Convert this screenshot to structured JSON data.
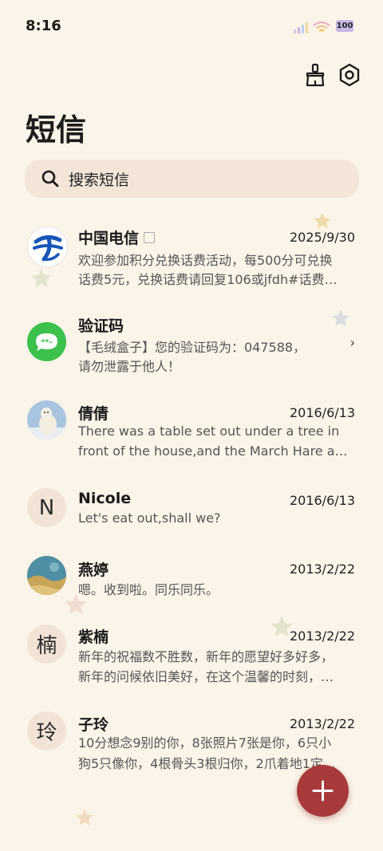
{
  "status": {
    "time": "8:16",
    "battery": "100"
  },
  "header": {
    "title": "短信",
    "icons": [
      "broom-icon",
      "settings-icon"
    ]
  },
  "search": {
    "placeholder": "搜索短信"
  },
  "messages": [
    {
      "name": "中国电信",
      "date": "2025/9/30",
      "line1": "欢迎参加积分兑换话费活动，每500分可兑换",
      "line2": "话费5元，兑换话费请回复106或jfdh#话费…"
    },
    {
      "name": "验证码",
      "date": "",
      "line1": "【毛绒盒子】您的验证码为：047588，",
      "line2": "请勿泄露于他人！",
      "chevron": "›"
    },
    {
      "name": "倩倩",
      "date": "2016/6/13",
      "line1": "There was a table set out under a tree in",
      "line2": "front of the house,and the March Hare an…"
    },
    {
      "name": "Nicole",
      "date": "2016/6/13",
      "line1": "Let's eat out,shall we?",
      "avatar_letter": "N"
    },
    {
      "name": "燕婷",
      "date": "2013/2/22",
      "line1": "嗯。收到啦。同乐同乐。"
    },
    {
      "name": "紫楠",
      "date": "2013/2/22",
      "line1": "新年的祝福数不胜数，新年的愿望好多好多，",
      "line2": "新年的问候依旧美好，在这个温馨的时刻，…",
      "avatar_letter": "楠"
    },
    {
      "name": "子玲",
      "date": "2013/2/22",
      "line1": "10分想念9别的你，8张照片7张是你，6只小",
      "line2": "狗5只像你，4根骨头3根归你，2爪着地1定…",
      "avatar_letter": "玲"
    }
  ],
  "fab": {
    "icon": "plus-icon"
  },
  "colors": {
    "background": "#fbf4e8",
    "accent": "#a83a3c",
    "search_bg": "#f3e6d9"
  }
}
